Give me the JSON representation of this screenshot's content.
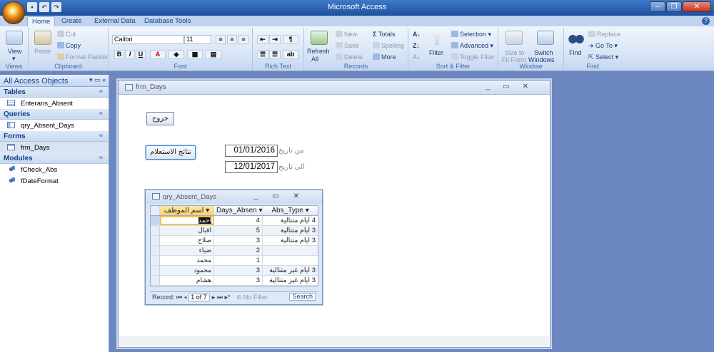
{
  "app": {
    "title": "Microsoft Access"
  },
  "tabs": [
    "Home",
    "Create",
    "External Data",
    "Database Tools"
  ],
  "ribbon": {
    "groups": {
      "views": "Views",
      "clipboard": "Clipboard",
      "font": "Font",
      "rich_text": "Rich Text",
      "records": "Records",
      "sort_filter": "Sort & Filter",
      "window": "Window",
      "find": "Find"
    },
    "view_label": "View",
    "paste_label": "Paste",
    "cut_label": "Cut",
    "copy_label": "Copy",
    "format_painter_label": "Format Painter",
    "font_name": "Calibri",
    "font_size": "11",
    "bold": "B",
    "italic": "I",
    "underline": "U",
    "refresh_label": "Refresh",
    "refresh_sub": "All",
    "new_label": "New",
    "save_label": "Save",
    "delete_label": "Delete",
    "totals_label": "Totals",
    "spelling_label": "Spelling",
    "more_label": "More",
    "filter_label": "Filter",
    "selection_label": "Selection",
    "advanced_label": "Advanced",
    "toggle_filter_label": "Toggle Filter",
    "size_to_fit_label": "Size to",
    "size_to_fit_sub": "Fit Form",
    "switch_windows_label": "Switch",
    "switch_windows_sub": "Windows",
    "find_label": "Find",
    "replace_label": "Replace",
    "goto_label": "Go To",
    "select_label": "Select"
  },
  "nav": {
    "header": "All Access Objects",
    "groups": [
      {
        "name": "Tables",
        "items": [
          "Enterans_Absent"
        ]
      },
      {
        "name": "Queries",
        "items": [
          "qry_Absent_Days"
        ]
      },
      {
        "name": "Forms",
        "items": [
          "frm_Days"
        ]
      },
      {
        "name": "Modules",
        "items": [
          "fCheck_Abs",
          "fDateFormat"
        ]
      }
    ]
  },
  "form": {
    "title": "frm_Days",
    "exit_button": "خروج",
    "results_button": "نتائج الاستعلام",
    "from_label": "من تاريخ",
    "from_value": "01/01/2016",
    "to_label": "الى تاريخ",
    "to_value": "12/01/2017"
  },
  "subform": {
    "title": "qry_Absent_Days",
    "columns": [
      "اسم الموظف",
      "Days_Absen",
      "Abs_Type"
    ],
    "rows": [
      {
        "name": "احمد",
        "days": "4",
        "type": "4 ايام متتالية"
      },
      {
        "name": "اقبال",
        "days": "5",
        "type": "3 ايام متتالية"
      },
      {
        "name": "صلاح",
        "days": "3",
        "type": "3 ايام متتالية"
      },
      {
        "name": "ضياء",
        "days": "2",
        "type": ""
      },
      {
        "name": "محمد",
        "days": "1",
        "type": ""
      },
      {
        "name": "محمود",
        "days": "3",
        "type": "3 ايام غير متتالية"
      },
      {
        "name": "هشام",
        "days": "3",
        "type": "3 ايام غير متتالية"
      }
    ],
    "record_label": "Record:",
    "record_position": "1 of 7",
    "no_filter_label": "No Filter",
    "search_label": "Search"
  }
}
